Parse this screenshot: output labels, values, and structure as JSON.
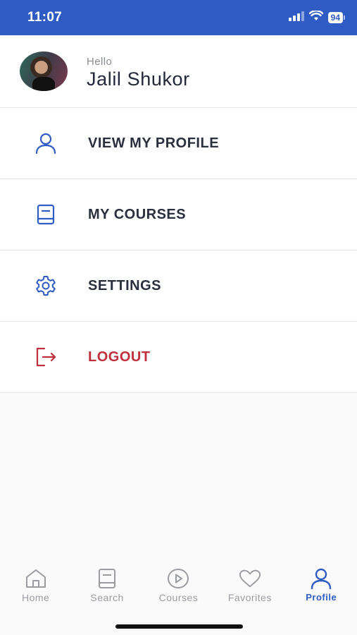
{
  "status": {
    "time": "11:07",
    "battery": "94"
  },
  "profile": {
    "greeting": "Hello",
    "name": "Jalil Shukor"
  },
  "menu": {
    "items": [
      {
        "label": "VIEW MY PROFILE",
        "icon": "user-icon"
      },
      {
        "label": "MY COURSES",
        "icon": "book-icon"
      },
      {
        "label": "SETTINGS",
        "icon": "gear-icon"
      },
      {
        "label": "LOGOUT",
        "icon": "logout-icon",
        "color": "#c0303c"
      }
    ]
  },
  "tabs": [
    {
      "label": "Home",
      "icon": "home-icon",
      "active": false
    },
    {
      "label": "Search",
      "icon": "book-icon",
      "active": false
    },
    {
      "label": "Courses",
      "icon": "play-circle-icon",
      "active": false
    },
    {
      "label": "Favorites",
      "icon": "heart-icon",
      "active": false
    },
    {
      "label": "Profile",
      "icon": "user-icon",
      "active": true
    }
  ],
  "colors": {
    "accent": "#2f5bc4",
    "danger": "#c0303c",
    "inactive": "#9a9ca2"
  }
}
